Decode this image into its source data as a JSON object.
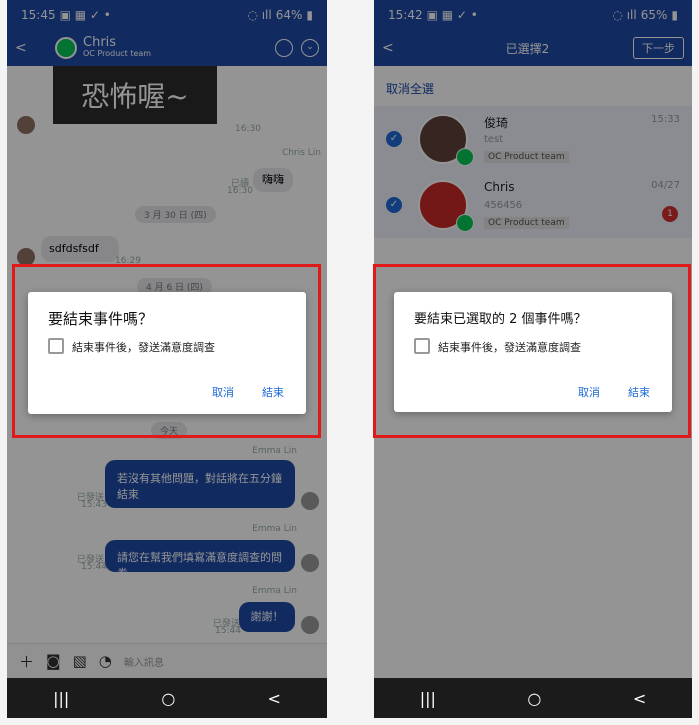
{
  "left": {
    "status": {
      "time": "15:45",
      "battery": "64%"
    },
    "header": {
      "name": "Chris",
      "subtitle": "OC Product team"
    },
    "chat": {
      "sticker_text": "恐怖喔~",
      "sticker_time": "16:30",
      "msg1_sender": "Chris Lin",
      "msg1_read": "已讀",
      "msg1_time": "16:30",
      "msg1_text": "嗨嗨",
      "date1": "3 月 30 日 (四)",
      "msg2_text": "sdfdsfsdf",
      "msg2_time": "16:29",
      "date2": "4 月 6 日 (四)",
      "date3": "今天",
      "e1_sender": "Emma Lin",
      "e1_status": "已發送",
      "e1_time": "15:43",
      "e1_text": "若沒有其他問題，對話將在五分鐘結束",
      "e2_sender": "Emma Lin",
      "e2_status": "已發送",
      "e2_time": "15:44",
      "e2_text": "請您在幫我們填寫滿意度調查的問券",
      "e3_sender": "Emma Lin",
      "e3_status": "已發送",
      "e3_time": "15:44",
      "e3_text": "謝謝！"
    },
    "input_placeholder": "輸入訊息",
    "dialog": {
      "title": "要結束事件嗎？",
      "checkbox_label": "結束事件後，發送滿意度調查",
      "cancel": "取消",
      "confirm": "結束"
    }
  },
  "right": {
    "status": {
      "time": "15:42",
      "battery": "65%"
    },
    "header": {
      "title": "已選擇2",
      "next": "下一步"
    },
    "cancel_all": "取消全選",
    "items": [
      {
        "name": "俊琦",
        "preview": "test",
        "tag": "OC Product team",
        "time": "15:33"
      },
      {
        "name": "Chris",
        "preview": "456456",
        "tag": "OC Product team",
        "time": "04/27",
        "unread": "1"
      }
    ],
    "dialog": {
      "title": "要結束已選取的 2 個事件嗎？",
      "checkbox_label": "結束事件後，發送滿意度調查",
      "cancel": "取消",
      "confirm": "結束"
    }
  },
  "nav": {
    "recents": "|||",
    "home": "○",
    "back": "<"
  },
  "colors": {
    "primary": "#1e49a6",
    "accent": "#1e6ad6",
    "line_green": "#06c755",
    "alert_red": "#e0191b"
  }
}
